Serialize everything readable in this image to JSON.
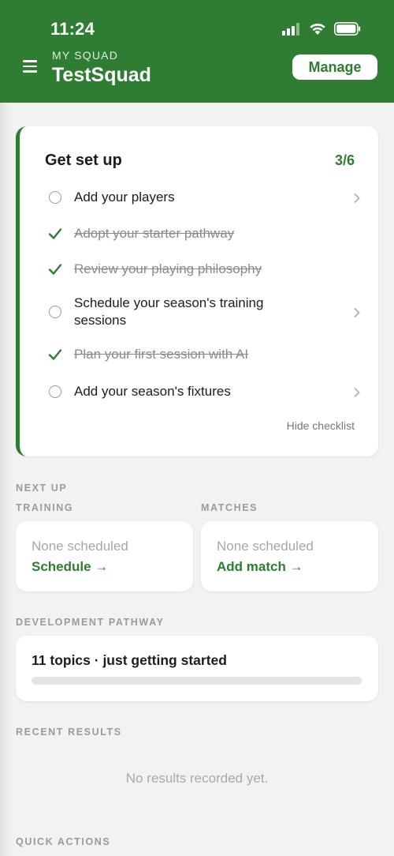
{
  "status_bar": {
    "time": "11:24"
  },
  "header": {
    "eyebrow": "MY SQUAD",
    "squad_name": "TestSquad",
    "manage_label": "Manage",
    "color": "#2e7d32"
  },
  "setup": {
    "title": "Get set up",
    "progress": "3/6",
    "items": [
      {
        "label": "Add your players",
        "done": false
      },
      {
        "label": "Adopt your starter pathway",
        "done": true
      },
      {
        "label": "Review your playing philosophy",
        "done": true
      },
      {
        "label": "Schedule your season's training sessions",
        "done": false
      },
      {
        "label": "Plan your first session with AI",
        "done": true
      },
      {
        "label": "Add your season's fixtures",
        "done": false
      }
    ],
    "hide_label": "Hide checklist"
  },
  "next_up": {
    "label": "NEXT UP",
    "training": {
      "label": "TRAINING",
      "empty": "None scheduled",
      "action": "Schedule →"
    },
    "matches": {
      "label": "MATCHES",
      "empty": "None scheduled",
      "action": "Add match →"
    }
  },
  "pathway": {
    "label": "DEVELOPMENT PATHWAY",
    "summary": "11 topics · just getting started",
    "progress_fraction": 0
  },
  "recent_results": {
    "label": "RECENT RESULTS",
    "empty": "No results recorded yet."
  },
  "quick_actions": {
    "label": "QUICK ACTIONS"
  }
}
